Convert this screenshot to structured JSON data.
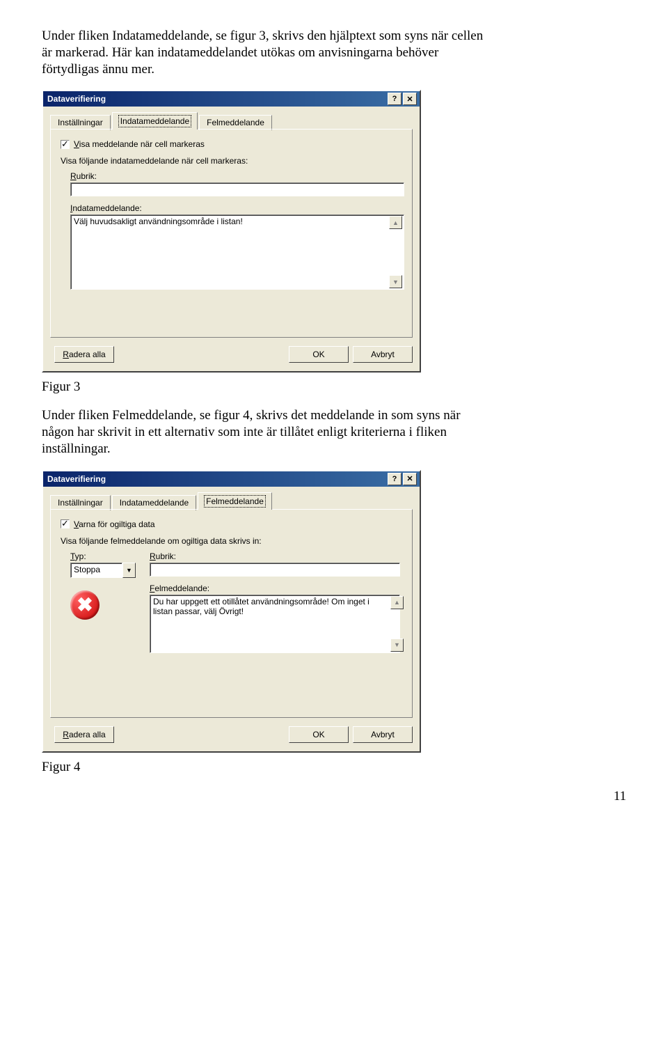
{
  "intro1": "Under fliken Indatameddelande, se figur 3, skrivs den hjälptext som syns när cellen är markerad. Här kan indatameddelandet utökas om anvisningarna behöver förtydligas ännu mer.",
  "dialog1": {
    "title": "Dataverifiering",
    "tabs": {
      "settings": "Inställningar",
      "input": "Indatameddelande",
      "error": "Felmeddelande"
    },
    "checkbox_pre": "V",
    "checkbox_label": "isa meddelande när cell markeras",
    "subheading": "Visa följande indatameddelande när cell markeras:",
    "rubrik_pre": "R",
    "rubrik_label": "ubrik:",
    "rubrik_value": "",
    "msg_pre": "I",
    "msg_label": "ndatameddelande:",
    "msg_value": "Välj huvudsakligt användningsområde i listan!",
    "clear_pre": "R",
    "clear": "adera alla",
    "ok": "OK",
    "cancel": "Avbryt"
  },
  "caption1": "Figur 3",
  "intro2": "Under fliken Felmeddelande, se figur 4, skrivs det meddelande in som syns när någon har skrivit in ett alternativ som inte är tillåtet enligt kriterierna i fliken inställningar.",
  "dialog2": {
    "title": "Dataverifiering",
    "tabs": {
      "settings": "Inställningar",
      "input": "Indatameddelande",
      "error": "Felmeddelande"
    },
    "checkbox_pre": "V",
    "checkbox_label": "arna för ogiltiga data",
    "subheading": "Visa följande felmeddelande om ogiltiga data skrivs in:",
    "typ_pre": "T",
    "typ_label": "yp:",
    "typ_value": "Stoppa",
    "rubrik_pre": "R",
    "rubrik_label": "ubrik:",
    "rubrik_value": "",
    "msg_pre": "F",
    "msg_label": "elmeddelande:",
    "msg_value": "Du har uppgett ett otillåtet användningsområde! Om inget i listan passar, välj Övrigt!",
    "clear_pre": "R",
    "clear": "adera alla",
    "ok": "OK",
    "cancel": "Avbryt"
  },
  "caption2": "Figur 4",
  "page_number": "11"
}
